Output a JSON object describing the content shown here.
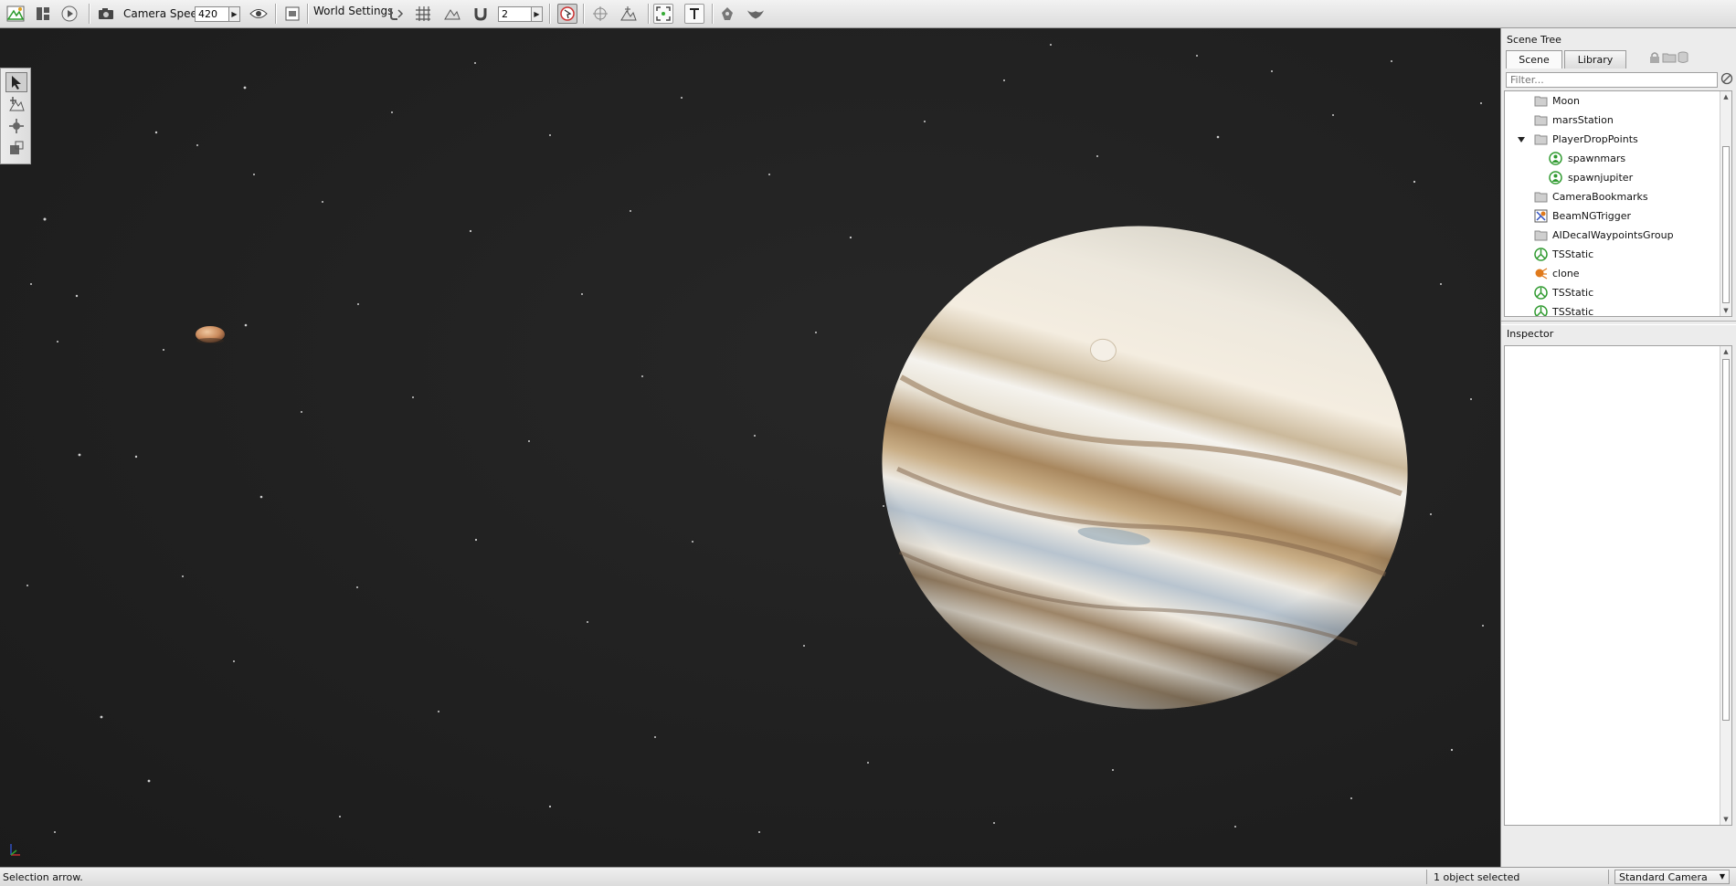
{
  "toolbar": {
    "camera_speed_label": "Camera Speed",
    "camera_speed_value": "420",
    "world_settings_label": "World Settings",
    "snap_value": "2"
  },
  "scene_tree": {
    "title": "Scene Tree",
    "tabs": [
      {
        "label": "Scene",
        "active": true
      },
      {
        "label": "Library",
        "active": false
      }
    ],
    "filter_placeholder": "Filter...",
    "items": [
      {
        "label": "Moon",
        "icon": "folder-icon",
        "indent": 1
      },
      {
        "label": "marsStation",
        "icon": "folder-icon",
        "indent": 1
      },
      {
        "label": "PlayerDropPoints",
        "icon": "folder-icon",
        "indent": 1,
        "expanded": true
      },
      {
        "label": "spawnmars",
        "icon": "spawn-point-icon",
        "indent": 2
      },
      {
        "label": "spawnjupiter",
        "icon": "spawn-point-icon",
        "indent": 2
      },
      {
        "label": "CameraBookmarks",
        "icon": "folder-icon",
        "indent": 1
      },
      {
        "label": "BeamNGTrigger",
        "icon": "trigger-icon",
        "indent": 1
      },
      {
        "label": "AIDecalWaypointsGroup",
        "icon": "folder-icon",
        "indent": 1
      },
      {
        "label": "TSStatic",
        "icon": "tsstatic-icon",
        "indent": 1
      },
      {
        "label": "clone",
        "icon": "light-icon",
        "indent": 1
      },
      {
        "label": "TSStatic",
        "icon": "tsstatic-icon",
        "indent": 1
      },
      {
        "label": "TSStatic",
        "icon": "tsstatic-icon",
        "indent": 1
      }
    ]
  },
  "inspector": {
    "title": "Inspector"
  },
  "status": {
    "hint": "Selection arrow.",
    "selection": "1 object selected",
    "camera_mode": "Standard Camera"
  },
  "colors": {
    "space_background": "#1e1e1e",
    "jupiter_light": "#f2eee6",
    "jupiter_band": "#a8875e",
    "spawn_green": "#2f9a2f",
    "trigger_orange": "#e07a1c"
  }
}
